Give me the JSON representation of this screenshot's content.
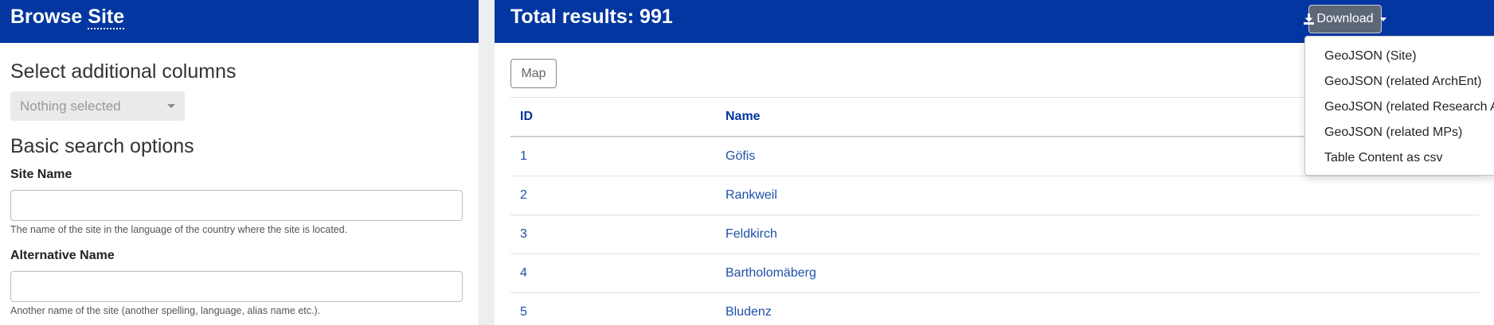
{
  "left": {
    "title_prefix": "Browse",
    "title_entity": "Site",
    "columns_title": "Select additional columns",
    "columns_select_placeholder": "Nothing selected",
    "basic_search_title": "Basic search options",
    "fields": [
      {
        "label": "Site Name",
        "value": "",
        "help": "The name of the site in the language of the country where the site is located."
      },
      {
        "label": "Alternative Name",
        "value": "",
        "help": "Another name of the site (another spelling, language, alias name etc.)."
      }
    ]
  },
  "right": {
    "total_results": "Total results: 991",
    "download_label": "Download",
    "map_label": "Map",
    "table": {
      "headers": [
        "ID",
        "Name"
      ],
      "rows": [
        {
          "id": "1",
          "name": "Göfis"
        },
        {
          "id": "2",
          "name": "Rankweil"
        },
        {
          "id": "3",
          "name": "Feldkirch"
        },
        {
          "id": "4",
          "name": "Bartholomäberg"
        },
        {
          "id": "5",
          "name": "Bludenz"
        }
      ]
    }
  },
  "download_menu": {
    "items": [
      "GeoJSON (Site)",
      "GeoJSON (related ArchEnt)",
      "GeoJSON (related Research Area)",
      "GeoJSON (related MPs)",
      "Table Content as csv"
    ]
  },
  "icons": {
    "download": "download-icon",
    "dropdown_caret": "chevron-down-icon"
  },
  "colors": {
    "header_bg": "#0336a0",
    "link": "#1e4fa8",
    "download_btn": "#5d6778"
  }
}
